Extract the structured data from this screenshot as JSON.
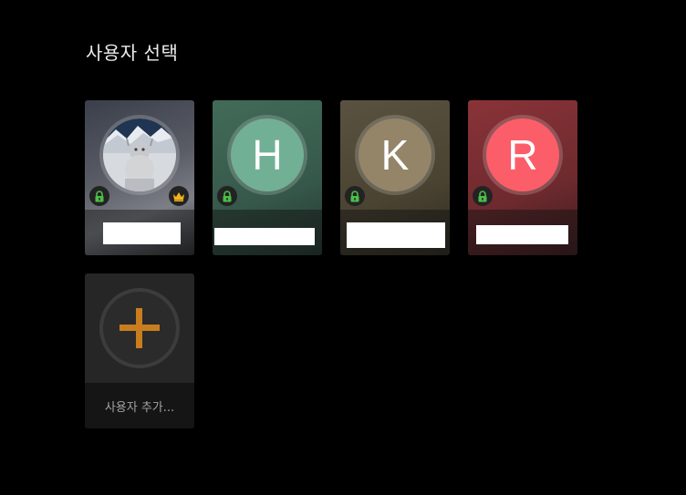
{
  "screen": {
    "title": "사용자 선택"
  },
  "profiles": [
    {
      "id": "snowman",
      "initial": "",
      "avatar_kind": "photo",
      "locked": true,
      "owner": true,
      "name": "",
      "color": "#8a8f9a"
    },
    {
      "id": "h",
      "initial": "H",
      "avatar_kind": "initial",
      "locked": true,
      "owner": false,
      "name": "",
      "color": "#72b095"
    },
    {
      "id": "k",
      "initial": "K",
      "avatar_kind": "initial",
      "locked": true,
      "owner": false,
      "name": "",
      "color": "#948569"
    },
    {
      "id": "r",
      "initial": "R",
      "avatar_kind": "initial",
      "locked": true,
      "owner": false,
      "name": "",
      "color": "#fb5e69"
    }
  ],
  "add_user": {
    "label": "사용자 추가...",
    "icon": "plus-icon",
    "accent": "#c97d1e"
  },
  "icons": {
    "lock": "lock-icon",
    "crown": "crown-icon"
  },
  "colors": {
    "lock_green": "#4cbe4a",
    "crown_gold": "#f5b21c"
  }
}
